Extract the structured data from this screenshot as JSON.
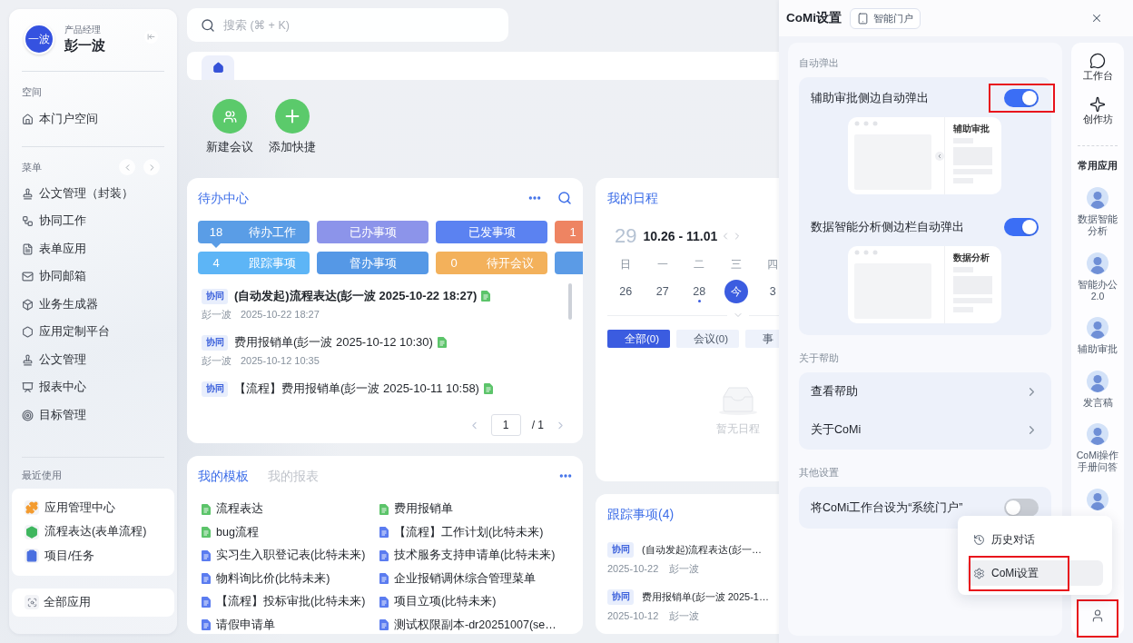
{
  "sidebar": {
    "user": {
      "avatar_text": "一波",
      "role": "产品经理",
      "name": "彭一波"
    },
    "space": {
      "heading": "空间",
      "items": [
        {
          "label": "本门户空间",
          "kind": "home"
        }
      ]
    },
    "menu": {
      "heading": "菜单",
      "items": [
        {
          "label": "公文管理（封装）",
          "kind": "stamp"
        },
        {
          "label": "协同工作",
          "kind": "flow"
        },
        {
          "label": "表单应用",
          "kind": "form"
        },
        {
          "label": "协同邮箱",
          "kind": "mail"
        },
        {
          "label": "业务生成器",
          "kind": "cube"
        },
        {
          "label": "应用定制平台",
          "kind": "platform"
        },
        {
          "label": "公文管理",
          "kind": "stamp"
        },
        {
          "label": "报表中心",
          "kind": "report"
        },
        {
          "label": "目标管理",
          "kind": "target"
        }
      ]
    },
    "recent": {
      "heading": "最近使用",
      "items": [
        {
          "label": "应用管理中心",
          "kind": "puzzle",
          "color": "#f39b2f"
        },
        {
          "label": "流程表达(表单流程)",
          "kind": "cube",
          "color": "#3fb65f"
        },
        {
          "label": "项目/任务",
          "kind": "clipboard",
          "color": "#4a6fe0"
        }
      ]
    },
    "all_apps": {
      "label": "全部应用"
    }
  },
  "search": {
    "placeholder": "搜索 (⌘ + K)"
  },
  "tabs": [
    {
      "kind": "home",
      "selected": true
    }
  ],
  "quick_actions": [
    {
      "label": "新建会议",
      "kind": "meeting"
    },
    {
      "label": "添加快捷",
      "kind": "add"
    }
  ],
  "todo": {
    "title": "待办中心",
    "tile_rows": [
      [
        {
          "count": "18",
          "label": "待办工作",
          "color": "#5a9de6",
          "selected": true
        },
        {
          "label": "已办事项",
          "color": "#8c94ea",
          "selected": false
        },
        {
          "label": "已发事项",
          "color": "#5b82f1",
          "selected": false
        },
        {
          "count": "1",
          "color": "#ee8462",
          "selected": false
        }
      ],
      [
        {
          "count": "4",
          "label": "跟踪事项",
          "color": "#5db5f6",
          "selected": false
        },
        {
          "label": "督办事项",
          "color": "#5598e6",
          "selected": false
        },
        {
          "count": "0",
          "label": "待开会议",
          "color": "#f3b15b",
          "selected": false
        },
        {
          "color": "#5b9be6",
          "selected": false
        }
      ]
    ],
    "items": [
      {
        "tag": "协同",
        "title": "(自动发起)流程表达(彭一波 2025-10-22 18:27)",
        "unread": true,
        "sender": "彭一波",
        "time": "2025-10-22 18:27"
      },
      {
        "tag": "协同",
        "title": "费用报销单(彭一波 2025-10-12 10:30)",
        "unread": false,
        "sender": "彭一波",
        "time": "2025-10-12 10:35"
      },
      {
        "tag": "协同",
        "title": "【流程】费用报销单(彭一波 2025-10-11 10:58)",
        "unread": false
      }
    ],
    "pagination": {
      "page": "1",
      "total": "/ 1"
    }
  },
  "schedule": {
    "title": "我的日程",
    "day": "29",
    "range": "10.26 - 11.01",
    "weekdays": [
      "日",
      "一",
      "二",
      "三",
      "四"
    ],
    "days": [
      {
        "label": "26",
        "selected": false,
        "dot": false
      },
      {
        "label": "27",
        "selected": false,
        "dot": false
      },
      {
        "label": "28",
        "selected": false,
        "dot": true
      },
      {
        "label": "今",
        "selected": true,
        "dot": false
      },
      {
        "label": "3",
        "selected": false,
        "dot": false
      }
    ],
    "filters": [
      {
        "label": "全部(0)",
        "selected": true
      },
      {
        "label": "会议(0)",
        "selected": false
      },
      {
        "label": "事",
        "selected": false
      }
    ],
    "empty": "暂无日程"
  },
  "templates": {
    "tabs": [
      {
        "label": "我的模板",
        "selected": true
      },
      {
        "label": "我的报表",
        "selected": false
      }
    ],
    "items": [
      {
        "label": "流程表达",
        "color": "#5cc46a"
      },
      {
        "label": "费用报销单",
        "color": "#5cc46a"
      },
      {
        "label": "bug流程",
        "color": "#5cc46a"
      },
      {
        "label": "【流程】工作计划(比特未来)",
        "color": "#5b7cf0"
      },
      {
        "label": "实习生入职登记表(比特未来)",
        "color": "#5b7cf0"
      },
      {
        "label": "技术服务支持申请单(比特未来)",
        "color": "#5b7cf0"
      },
      {
        "label": "物料询比价(比特未来)",
        "color": "#5b7cf0"
      },
      {
        "label": "企业报销调休综合管理菜单",
        "color": "#5b7cf0"
      },
      {
        "label": "【流程】投标审批(比特未来)",
        "color": "#5b7cf0"
      },
      {
        "label": "项目立项(比特未来)",
        "color": "#5b7cf0"
      },
      {
        "label": "请假申请单",
        "color": "#5b7cf0"
      },
      {
        "label": "测试权限副本-dr20251007(se…",
        "color": "#5b7cf0"
      }
    ]
  },
  "tracking": {
    "title": "跟踪事项(4)",
    "items": [
      {
        "tag": "协同",
        "title": "(自动发起)流程表达(彭一…",
        "date": "2025-10-22",
        "sender": "彭一波"
      },
      {
        "tag": "协同",
        "title": "费用报销单(彭一波 2025-1…",
        "date": "2025-10-12",
        "sender": "彭一波"
      }
    ]
  },
  "drawer": {
    "title": "CoMi设置",
    "chip": "智能门户",
    "sections": [
      {
        "heading": "自动弹出",
        "rows": [
          {
            "kind": "toggle",
            "label": "辅助审批侧边自动弹出",
            "on": true,
            "highlighted": true,
            "preview": {
              "title": "辅助审批",
              "handle": true
            }
          },
          {
            "kind": "toggle",
            "label": "数据智能分析侧边栏自动弹出",
            "on": true,
            "highlighted": false,
            "preview": {
              "title": "数据分析",
              "handle": false
            }
          }
        ]
      },
      {
        "heading": "关于帮助",
        "rows": [
          {
            "kind": "link",
            "label": "查看帮助"
          },
          {
            "kind": "link",
            "label": "关于CoMi"
          }
        ]
      },
      {
        "heading": "其他设置",
        "rows": [
          {
            "kind": "toggle",
            "label": "将CoMi工作台设为“系统门户”",
            "on": false,
            "highlighted": false
          }
        ]
      }
    ],
    "rail": {
      "tools": [
        {
          "label": "工作台",
          "kind": "chat"
        },
        {
          "label": "创作坊",
          "kind": "sparkle"
        }
      ],
      "apps_heading": "常用应用",
      "apps": [
        {
          "kind": "assistant",
          "label": "数据智能分析"
        },
        {
          "kind": "assistant",
          "label": "智能办公2.0"
        },
        {
          "kind": "assistant",
          "label": "辅助审批"
        },
        {
          "kind": "assistant",
          "label": "发言稿"
        },
        {
          "kind": "assistant",
          "label": "CoMi操作手册问答"
        },
        {
          "kind": "assistant"
        }
      ],
      "user_button": {
        "highlighted": true
      }
    },
    "menu": [
      {
        "label": "历史对话",
        "kind": "history",
        "selected": false,
        "highlighted": false
      },
      {
        "label": "CoMi设置",
        "kind": "settings",
        "selected": true,
        "highlighted": true
      }
    ]
  }
}
